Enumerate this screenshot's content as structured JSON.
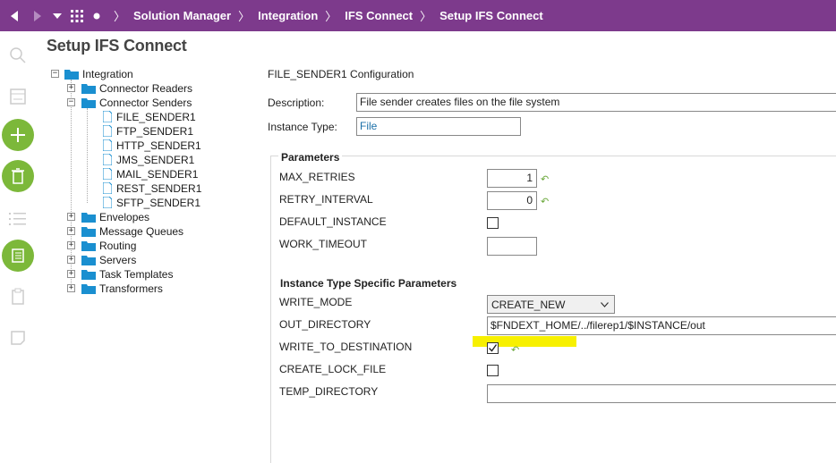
{
  "breadcrumb": [
    "Solution Manager",
    "Integration",
    "IFS Connect",
    "Setup IFS Connect"
  ],
  "page_title": "Setup IFS Connect",
  "tree": {
    "root": "Integration",
    "items": [
      {
        "label": "Connector Readers",
        "type": "folder",
        "expander": "+"
      },
      {
        "label": "Connector Senders",
        "type": "folder",
        "expander": "−"
      },
      {
        "label": "FILE_SENDER1",
        "type": "doc"
      },
      {
        "label": "FTP_SENDER1",
        "type": "doc"
      },
      {
        "label": "HTTP_SENDER1",
        "type": "doc"
      },
      {
        "label": "JMS_SENDER1",
        "type": "doc"
      },
      {
        "label": "MAIL_SENDER1",
        "type": "doc"
      },
      {
        "label": "REST_SENDER1",
        "type": "doc"
      },
      {
        "label": "SFTP_SENDER1",
        "type": "doc"
      },
      {
        "label": "Envelopes",
        "type": "folder",
        "expander": "+"
      },
      {
        "label": "Message Queues",
        "type": "folder",
        "expander": "+"
      },
      {
        "label": "Routing",
        "type": "folder",
        "expander": "+"
      },
      {
        "label": "Servers",
        "type": "folder",
        "expander": "+"
      },
      {
        "label": "Task Templates",
        "type": "folder",
        "expander": "+"
      },
      {
        "label": "Transformers",
        "type": "folder",
        "expander": "+"
      }
    ]
  },
  "config": {
    "title": "FILE_SENDER1 Configuration",
    "description_label": "Description:",
    "description_value": "File sender creates files on the file system",
    "instance_type_label": "Instance Type:",
    "instance_type_value": "File"
  },
  "parameters": {
    "title": "Parameters",
    "max_retries_label": "MAX_RETRIES",
    "max_retries_value": "1",
    "retry_interval_label": "RETRY_INTERVAL",
    "retry_interval_value": "0",
    "default_instance_label": "DEFAULT_INSTANCE",
    "default_instance_checked": false,
    "work_timeout_label": "WORK_TIMEOUT",
    "work_timeout_value": ""
  },
  "specific": {
    "title": "Instance Type Specific Parameters",
    "write_mode_label": "WRITE_MODE",
    "write_mode_value": "CREATE_NEW",
    "out_directory_label": "OUT_DIRECTORY",
    "out_directory_value": "$FNDEXT_HOME/../filerep1/$INSTANCE/out",
    "write_to_destination_label": "WRITE_TO_DESTINATION",
    "write_to_destination_checked": true,
    "create_lock_file_label": "CREATE_LOCK_FILE",
    "create_lock_file_checked": false,
    "temp_directory_label": "TEMP_DIRECTORY",
    "temp_directory_value": ""
  },
  "colors": {
    "topbar": "#7d3a8c",
    "accent_green": "#7cb83a",
    "folder_blue": "#1a8fd0",
    "highlight": "#f7f000"
  }
}
